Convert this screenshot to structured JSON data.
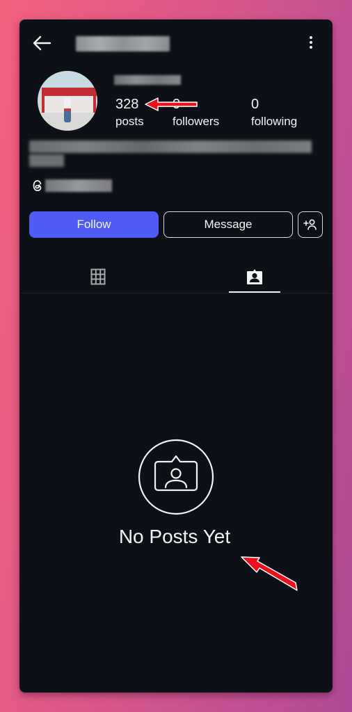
{
  "header": {
    "back_icon": "arrow-left-icon",
    "username": "[blurred]",
    "more_icon": "vertical-dots-icon"
  },
  "profile": {
    "display_name": "[blurred]",
    "bio": "[blurred]",
    "threads_handle": "[blurred]",
    "stats": [
      {
        "value": "328",
        "label": "posts"
      },
      {
        "value": "0",
        "label": "followers"
      },
      {
        "value": "0",
        "label": "following"
      }
    ]
  },
  "actions": {
    "follow_label": "Follow",
    "message_label": "Message",
    "suggest_icon": "add-person-icon"
  },
  "tabs": [
    {
      "name": "posts-grid",
      "icon": "grid-icon",
      "active": false
    },
    {
      "name": "tagged",
      "icon": "tagged-person-icon",
      "active": true
    }
  ],
  "empty_state": {
    "icon": "tagged-person-icon",
    "message": "No Posts Yet"
  },
  "colors": {
    "follow_button": "#4f5bf2",
    "background": "#0d1016",
    "annotation_arrow": "#e8121c"
  }
}
